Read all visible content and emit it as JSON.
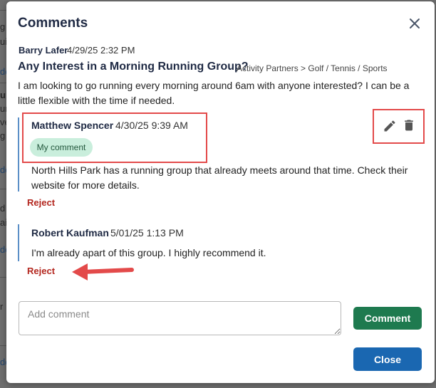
{
  "modal": {
    "title": "Comments",
    "close_icon": "close-icon"
  },
  "post": {
    "author": "Barry Lafer",
    "date": "4/29/25 2:32 PM",
    "title": "Any Interest in a Morning Running Group?",
    "category": "Activity Partners > Golf / Tennis / Sports",
    "body": "I am looking to go running every morning around 6am with anyone interested? I can be a little flexible with the time if needed."
  },
  "comments": [
    {
      "author": "Matthew Spencer",
      "date": "4/30/25 9:39 AM",
      "badge": "My comment",
      "body": "North Hills Park has a running group that already meets around that time. Check their website for more details.",
      "reject_label": "Reject",
      "actions": [
        "pencil-icon",
        "trash-icon"
      ]
    },
    {
      "author": "Robert Kaufman",
      "date": "5/01/25 1:13 PM",
      "body": "I'm already apart of this group. I highly recommend it.",
      "reject_label": "Reject"
    }
  ],
  "composer": {
    "placeholder": "Add comment",
    "value": ""
  },
  "buttons": {
    "comment": "Comment",
    "close": "Close"
  },
  "background_fragments": [
    "g",
    "ui",
    "do",
    "up",
    "ur",
    "ve",
    "g",
    "do",
    "d",
    "aid",
    "do",
    "r",
    "do"
  ],
  "colors": {
    "accent_green": "#1e7a4f",
    "accent_blue": "#1a67b1",
    "reject_red": "#b3261e",
    "badge_bg": "#c9eedc",
    "highlight_red": "#e34a4a",
    "thread_bar": "#5b8fc7"
  }
}
